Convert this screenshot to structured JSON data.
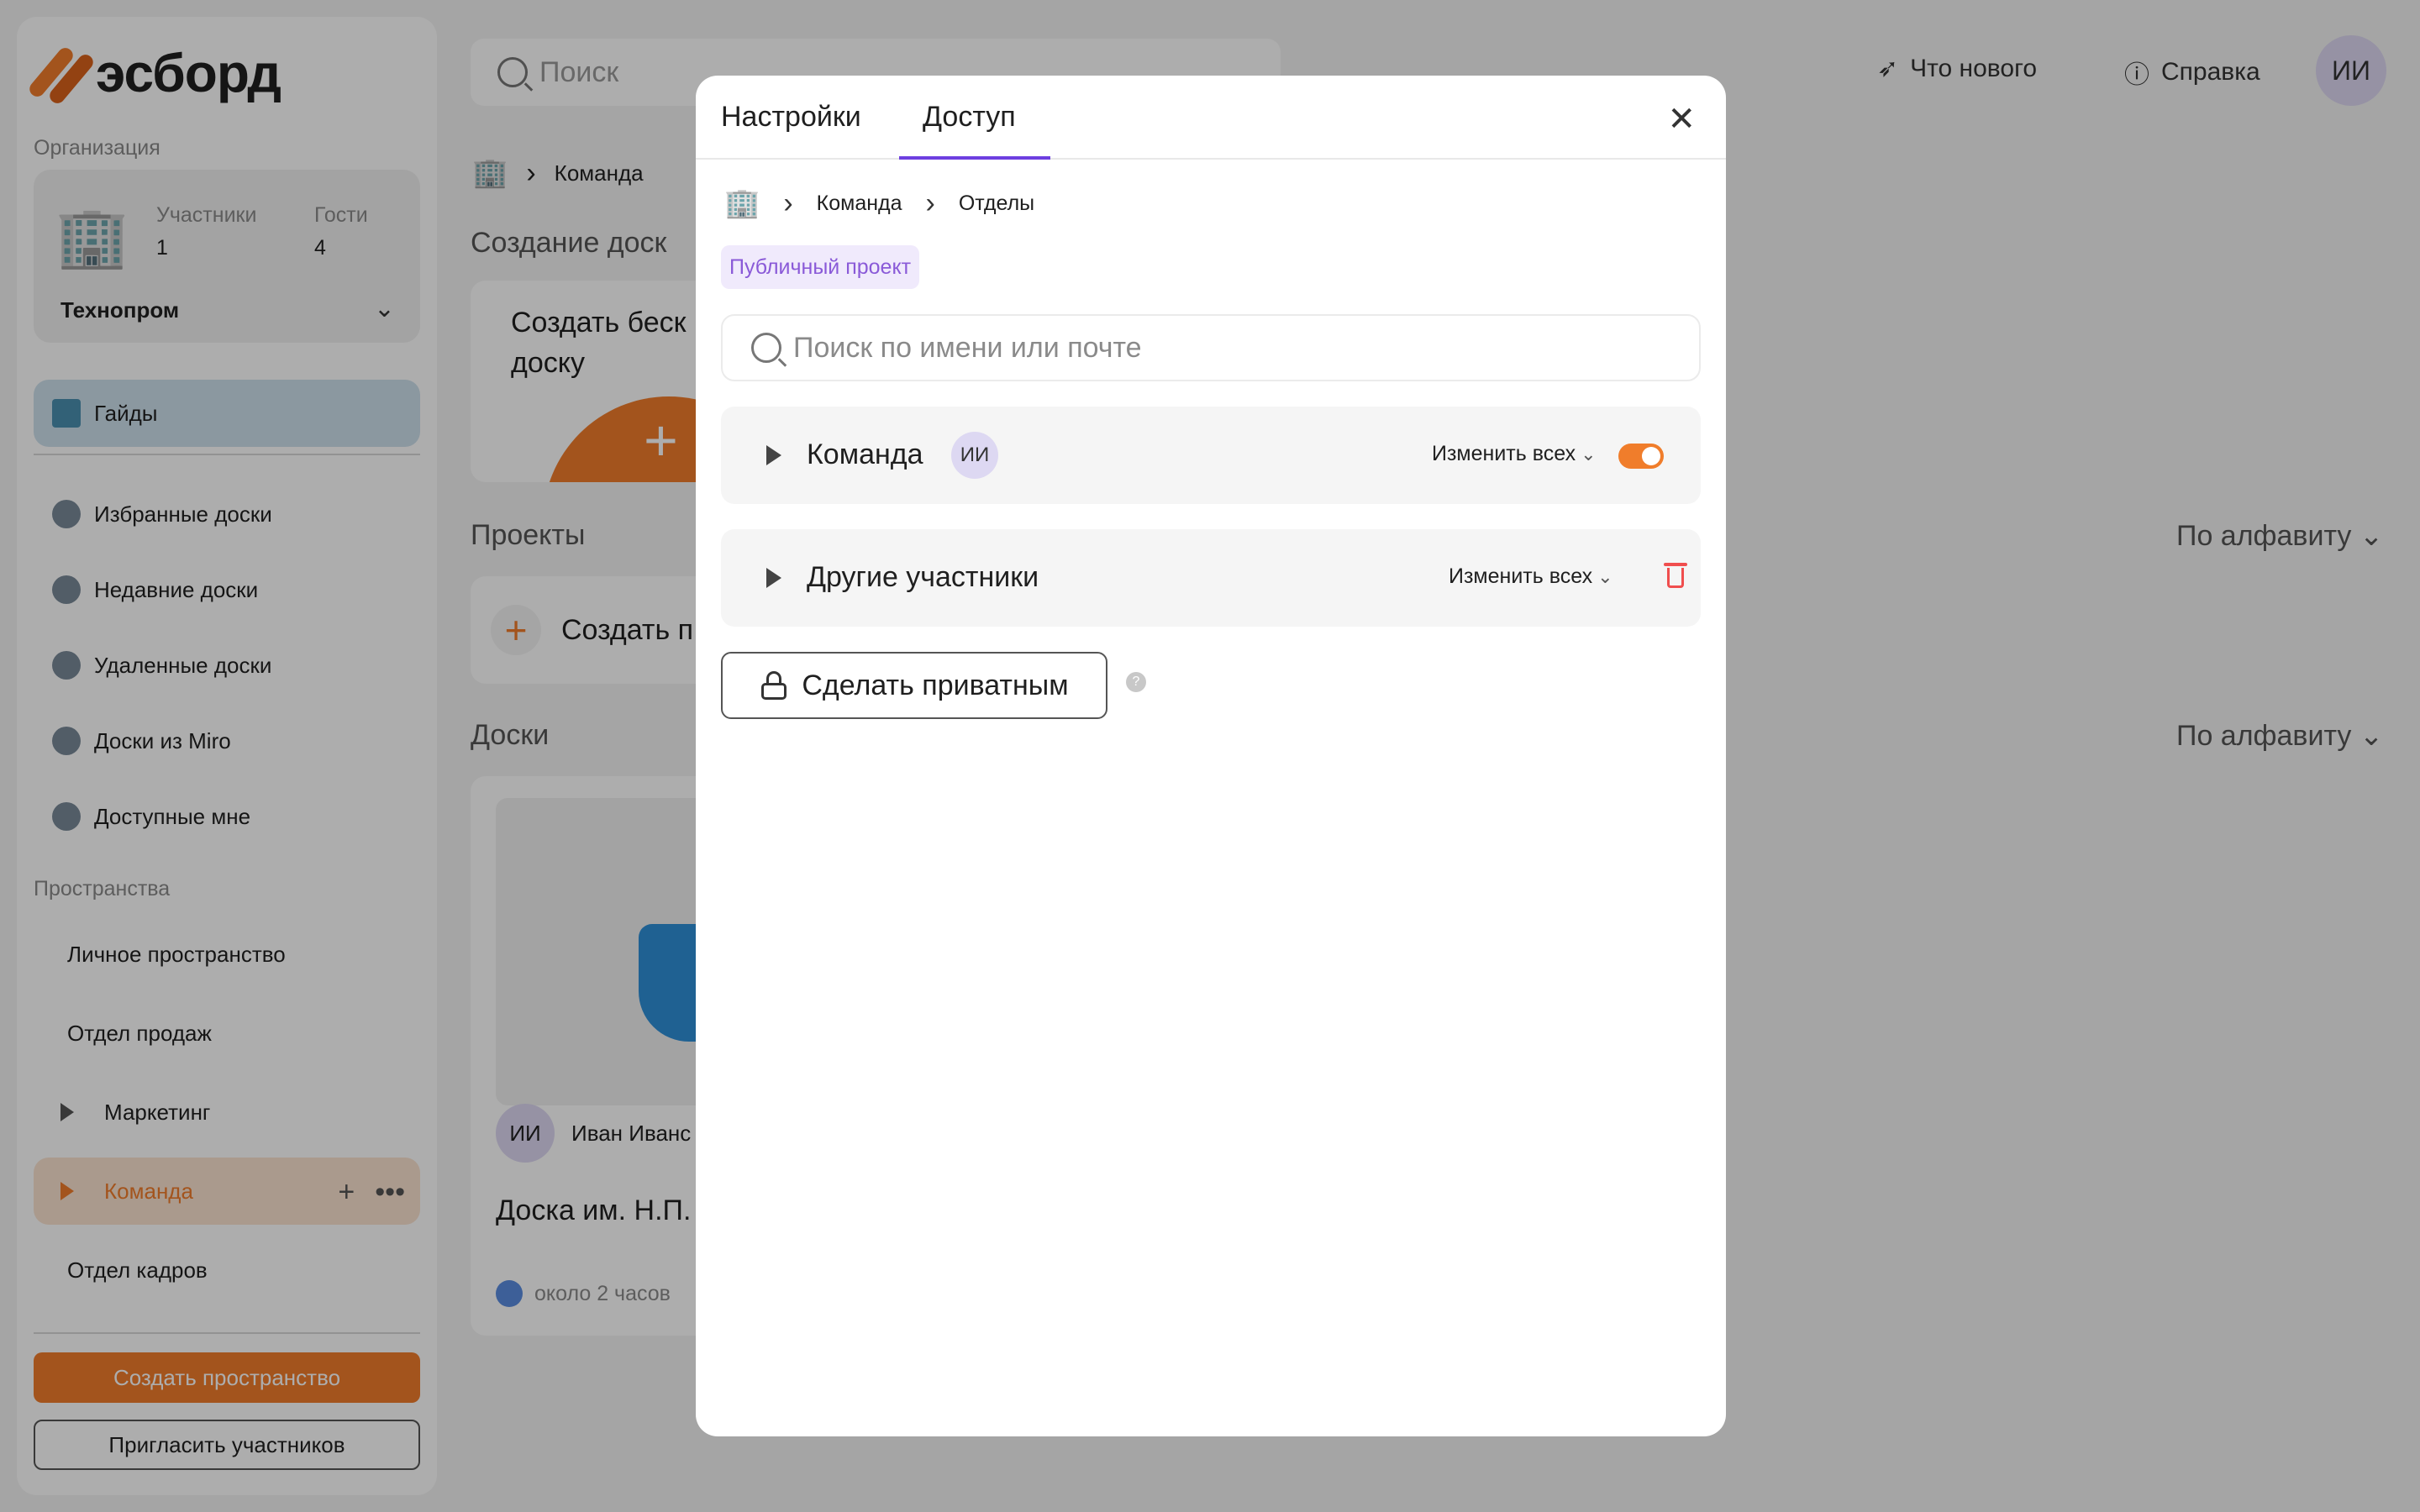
{
  "app": {
    "logo_text": "эсборд"
  },
  "sidebar": {
    "org_section_label": "Организация",
    "org": {
      "members_label": "Участники",
      "members_count": "1",
      "guests_label": "Гости",
      "guests_count": "4",
      "name": "Технопром"
    },
    "guides_label": "Гайды",
    "items": [
      {
        "label": "Избранные доски",
        "icon": "star-icon"
      },
      {
        "label": "Недавние доски",
        "icon": "clock-icon"
      },
      {
        "label": "Удаленные доски",
        "icon": "trash-icon"
      },
      {
        "label": "Доски из Miro",
        "icon": "miro-icon"
      },
      {
        "label": "Доступные мне",
        "icon": "shared-icon"
      }
    ],
    "spaces_label": "Пространства",
    "spaces": [
      {
        "label": "Личное пространство"
      },
      {
        "label": "Отдел продаж"
      },
      {
        "label": "Маркетинг"
      },
      {
        "label": "Команда"
      },
      {
        "label": "Отдел кадров"
      }
    ],
    "create_space_label": "Создать пространство",
    "invite_label": "Пригласить участников"
  },
  "topbar": {
    "search_placeholder": "Поиск",
    "whats_new_label": "Что нового",
    "help_label": "Справка",
    "avatar_initials": "ИИ"
  },
  "main": {
    "breadcrumb_current": "Команда",
    "create_board_heading": "Создание доск",
    "create_board_card_text": "Создать беск доску",
    "projects_heading": "Проекты",
    "projects_sort": "По алфавиту",
    "create_project_label": "Создать п",
    "boards_heading": "Доски",
    "boards_sort": "По алфавиту",
    "board": {
      "owner_initials": "ИИ",
      "owner_name": "Иван Иванс",
      "name": "Доска им. Н.П.",
      "time": "около 2 часов"
    }
  },
  "modal": {
    "tabs": [
      {
        "label": "Настройки"
      },
      {
        "label": "Доступ"
      }
    ],
    "active_tab": "Доступ",
    "breadcrumb": [
      "Команда",
      "Отделы"
    ],
    "public_badge": "Публичный проект",
    "search_placeholder": "Поиск по имени или почте",
    "groups": [
      {
        "name": "Команда",
        "avatar": "ИИ",
        "change_all": "Изменить всех",
        "toggle_on": true
      },
      {
        "name": "Другие участники",
        "change_all": "Изменить всех"
      }
    ],
    "make_private_label": "Сделать приватным",
    "help_glyph": "?"
  },
  "colors": {
    "accent": "#f07d2b",
    "tab_underline": "#6d3fe0",
    "danger": "#f04e4e",
    "badge_text": "#8a5ad8"
  }
}
